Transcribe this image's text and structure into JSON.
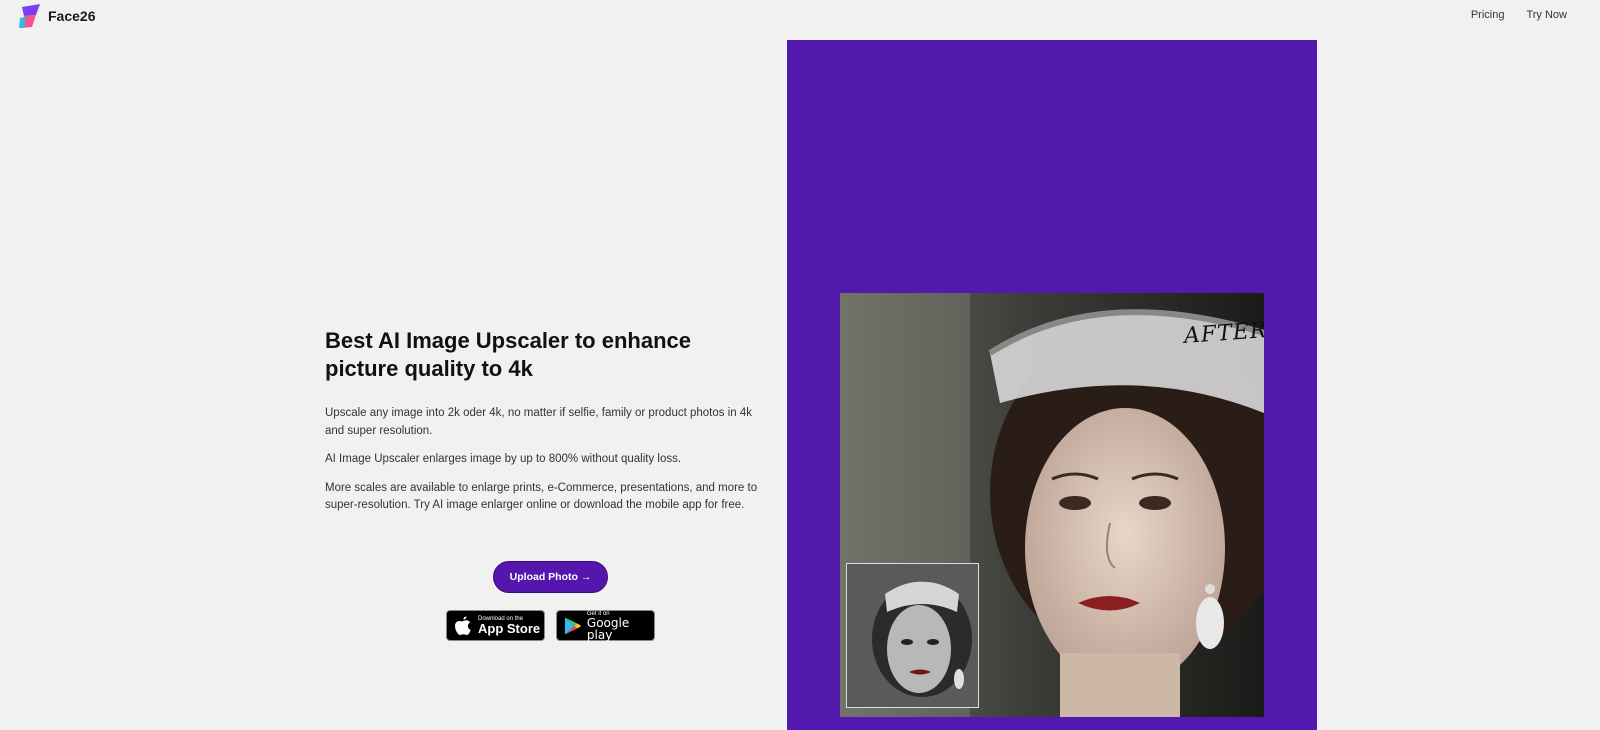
{
  "brand": {
    "name": "Face26"
  },
  "nav": {
    "pricing": "Pricing",
    "try_now": "Try Now"
  },
  "hero": {
    "title": "Best AI Image Upscaler to enhance picture quality to 4k",
    "paragraphs": [
      "Upscale any image into 2k oder 4k, no matter if selfie, family or product photos in 4k and super resolution.",
      "AI Image Upscaler enlarges image by up to 800% without quality loss.",
      "More scales are available to enlarge prints, e-Commerce, presentations, and more to super-resolution. Try AI image enlarger online or download the mobile app for free."
    ],
    "upload_button": "Upload Photo →"
  },
  "badges": {
    "appstore_small": "Download on the",
    "appstore_big": "App Store",
    "googleplay_small": "Get it on",
    "googleplay_big": "Google play"
  },
  "showcase": {
    "after_label": "AFTER"
  },
  "colors": {
    "brand_purple": "#5319ad",
    "button_purple": "#5416ac",
    "background": "#f1f1f1"
  },
  "icons": [
    "face26-logo-icon",
    "apple-icon",
    "google-play-icon",
    "arrow-right-icon"
  ]
}
